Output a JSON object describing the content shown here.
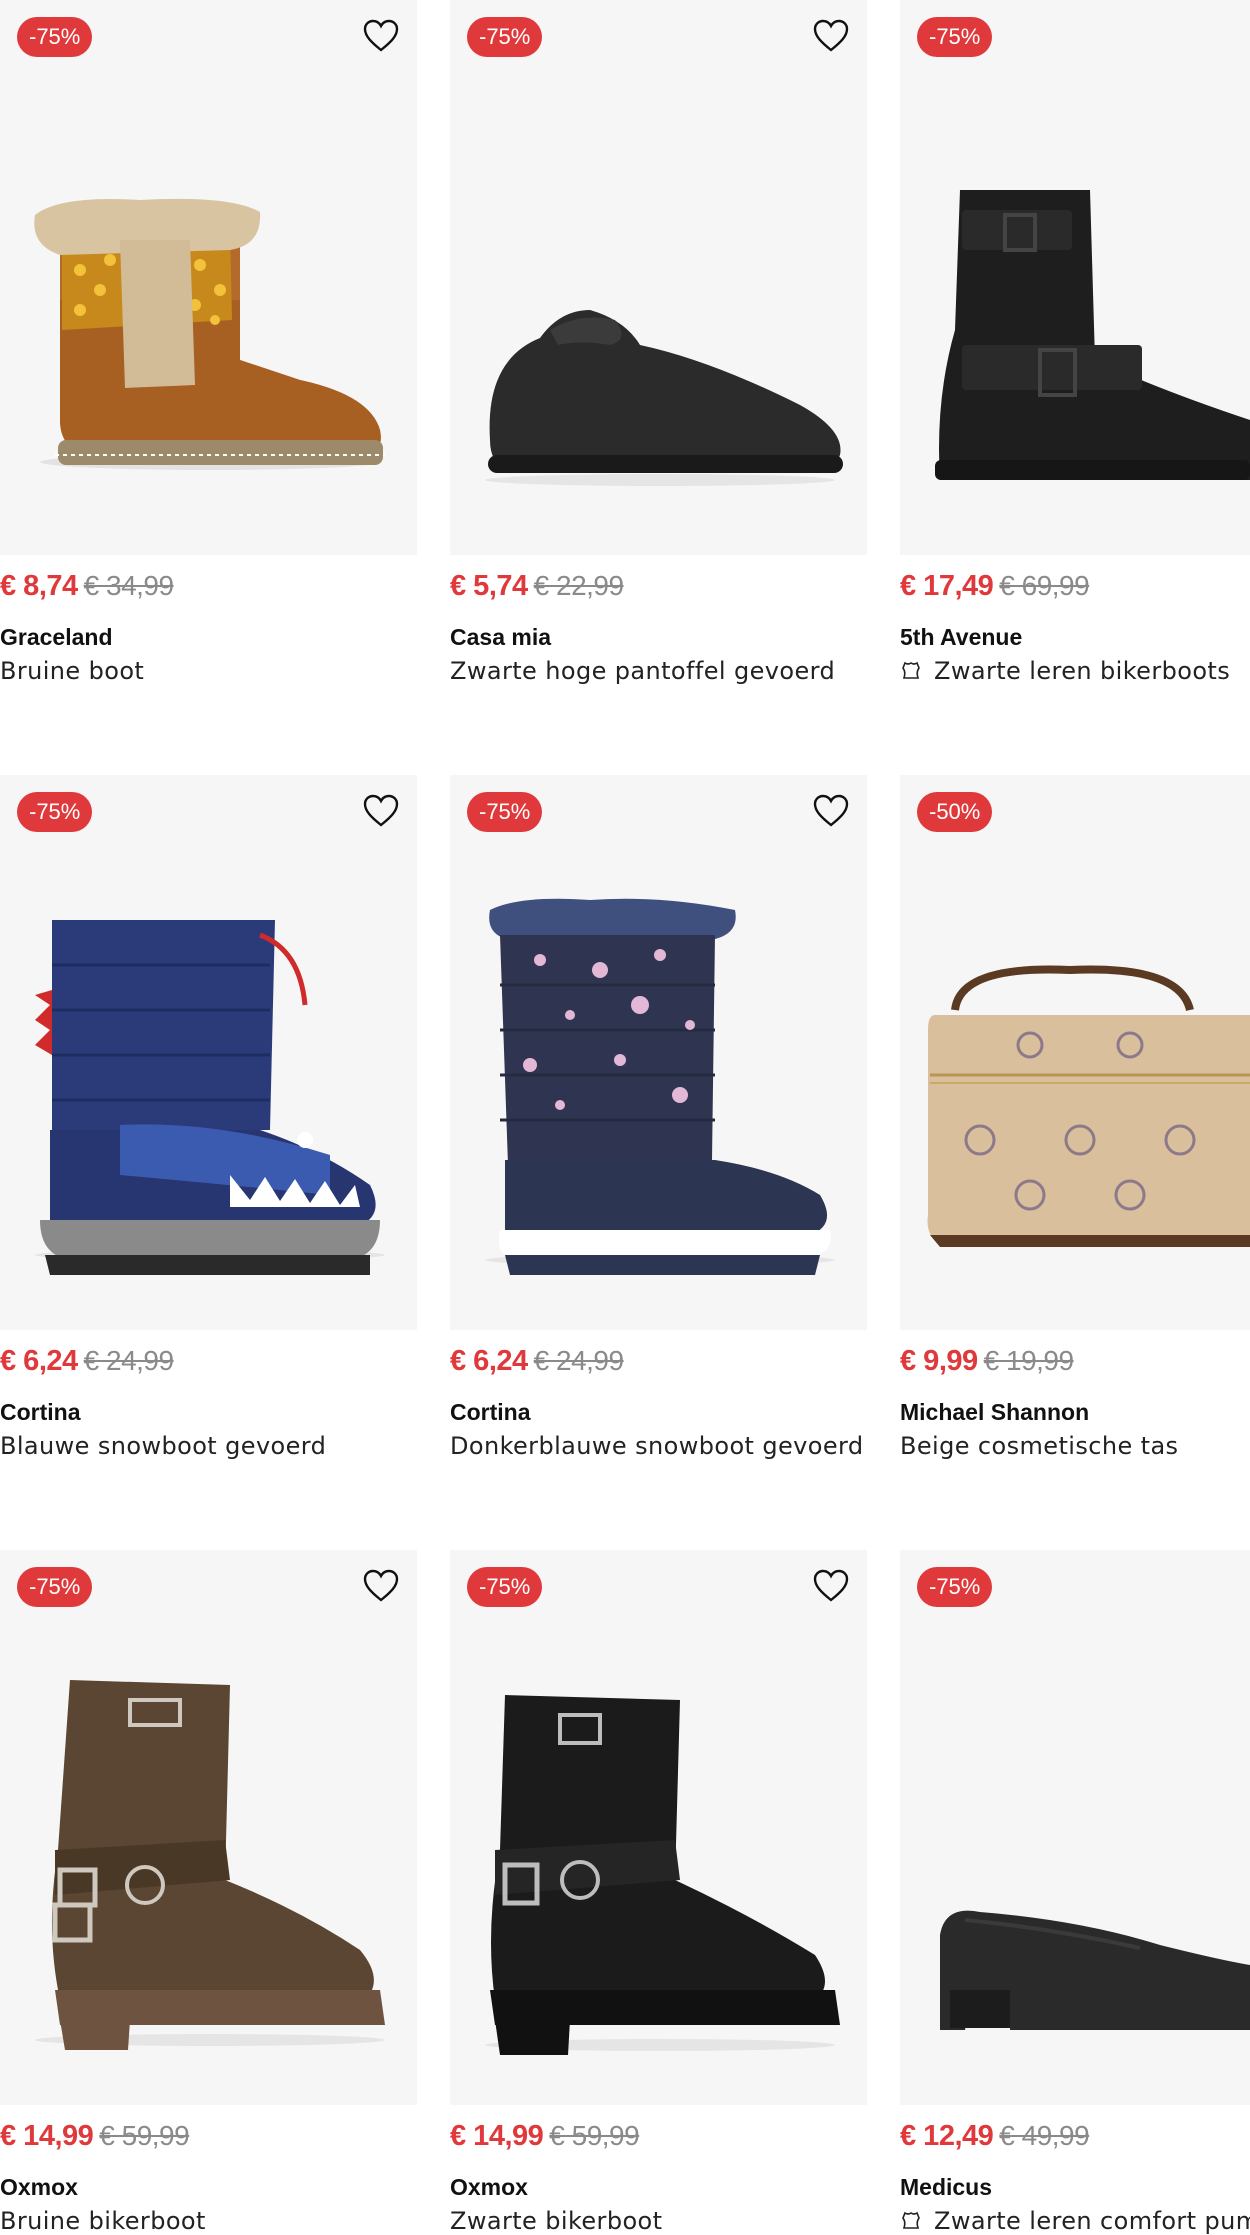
{
  "colors": {
    "badge": "#e0393b",
    "price": "#e0393b",
    "old_price": "#8a8a8a",
    "card_bg": "#f6f6f6"
  },
  "products": [
    {
      "badge": "-75%",
      "price": "€ 8,74",
      "old_price": "€ 34,99",
      "brand": "Graceland",
      "desc": "Bruine boot",
      "icon": "heart-icon",
      "leather": false,
      "favorite": true
    },
    {
      "badge": "-75%",
      "price": "€ 5,74",
      "old_price": "€ 22,99",
      "brand": "Casa mia",
      "desc": "Zwarte hoge pantoffel gevoerd",
      "icon": "heart-icon",
      "leather": false,
      "favorite": true
    },
    {
      "badge": "-75%",
      "price": "€ 17,49",
      "old_price": "€ 69,99",
      "brand": "5th Avenue",
      "desc": "Zwarte leren bikerboots",
      "icon": "heart-icon",
      "leather": true,
      "favorite": false
    },
    {
      "badge": "-75%",
      "price": "€ 6,24",
      "old_price": "€ 24,99",
      "brand": "Cortina",
      "desc": "Blauwe snowboot gevoerd",
      "icon": "heart-icon",
      "leather": false,
      "favorite": true
    },
    {
      "badge": "-75%",
      "price": "€ 6,24",
      "old_price": "€ 24,99",
      "brand": "Cortina",
      "desc": "Donkerblauwe snowboot gevoerd",
      "icon": "heart-icon",
      "leather": false,
      "favorite": true
    },
    {
      "badge": "-50%",
      "price": "€ 9,99",
      "old_price": "€ 19,99",
      "brand": "Michael Shannon",
      "desc": "Beige cosmetische tas",
      "icon": "heart-icon",
      "leather": false,
      "favorite": false
    },
    {
      "badge": "-75%",
      "price": "€ 14,99",
      "old_price": "€ 59,99",
      "brand": "Oxmox",
      "desc": "Bruine bikerboot",
      "icon": "heart-icon",
      "leather": false,
      "favorite": true
    },
    {
      "badge": "-75%",
      "price": "€ 14,99",
      "old_price": "€ 59,99",
      "brand": "Oxmox",
      "desc": "Zwarte bikerboot",
      "icon": "heart-icon",
      "leather": false,
      "favorite": true
    },
    {
      "badge": "-75%",
      "price": "€ 12,49",
      "old_price": "€ 49,99",
      "brand": "Medicus",
      "desc": "Zwarte leren comfort pump",
      "icon": "heart-icon",
      "leather": true,
      "favorite": false
    }
  ]
}
